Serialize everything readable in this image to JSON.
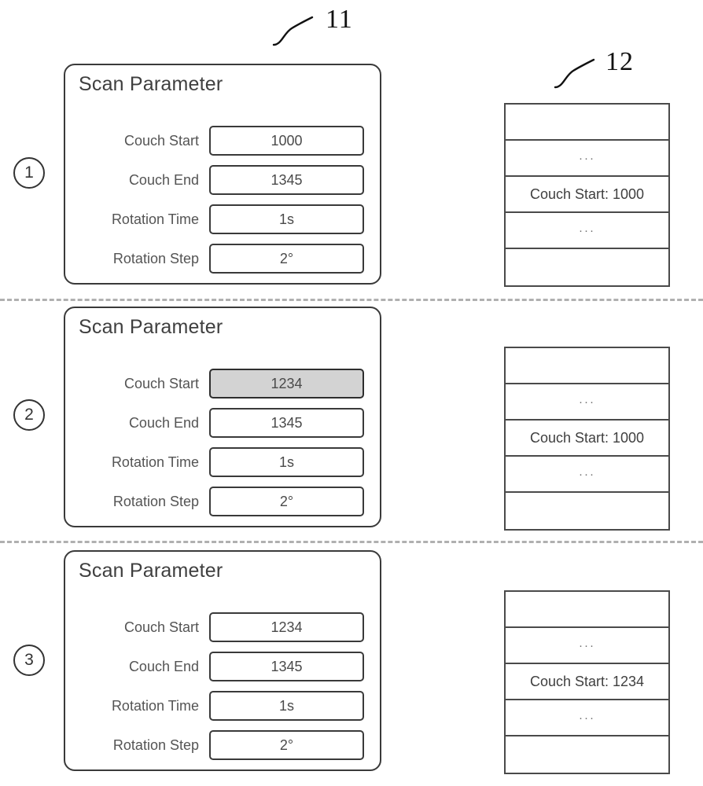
{
  "figure": {
    "refs": [
      {
        "id": "11",
        "label": "11",
        "target": "scan-parameter-dialog"
      },
      {
        "id": "12",
        "label": "12",
        "target": "record-table"
      }
    ]
  },
  "steps": [
    {
      "marker": "①",
      "marker_text": "1",
      "dialog": {
        "title": "Scan Parameter",
        "fields": [
          {
            "label": "Couch Start",
            "value": "1000",
            "highlighted": false
          },
          {
            "label": "Couch End",
            "value": "1345",
            "highlighted": false
          },
          {
            "label": "Rotation Time",
            "value": "1s",
            "highlighted": false
          },
          {
            "label": "Rotation Step",
            "value": "2°",
            "highlighted": false
          }
        ]
      },
      "table": {
        "rows": [
          {
            "text": ""
          },
          {
            "text": "···"
          },
          {
            "text": "Couch Start: 1000"
          },
          {
            "text": "···"
          },
          {
            "text": ""
          }
        ]
      }
    },
    {
      "marker": "②",
      "marker_text": "2",
      "dialog": {
        "title": "Scan Parameter",
        "fields": [
          {
            "label": "Couch Start",
            "value": "1234",
            "highlighted": true
          },
          {
            "label": "Couch End",
            "value": "1345",
            "highlighted": false
          },
          {
            "label": "Rotation Time",
            "value": "1s",
            "highlighted": false
          },
          {
            "label": "Rotation Step",
            "value": "2°",
            "highlighted": false
          }
        ]
      },
      "table": {
        "rows": [
          {
            "text": ""
          },
          {
            "text": "···"
          },
          {
            "text": "Couch Start: 1000"
          },
          {
            "text": "···"
          },
          {
            "text": ""
          }
        ]
      }
    },
    {
      "marker": "③",
      "marker_text": "3",
      "dialog": {
        "title": "Scan Parameter",
        "fields": [
          {
            "label": "Couch Start",
            "value": "1234",
            "highlighted": false
          },
          {
            "label": "Couch End",
            "value": "1345",
            "highlighted": false
          },
          {
            "label": "Rotation Time",
            "value": "1s",
            "highlighted": false
          },
          {
            "label": "Rotation Step",
            "value": "2°",
            "highlighted": false
          }
        ]
      },
      "table": {
        "rows": [
          {
            "text": ""
          },
          {
            "text": "···"
          },
          {
            "text": "Couch Start: 1234"
          },
          {
            "text": "···"
          },
          {
            "text": ""
          }
        ]
      }
    }
  ],
  "colors": {
    "stroke": "#3a3a3a",
    "highlight_fill": "#d3d3d3",
    "divider": "#b0b0b0",
    "text": "#3f3f3f"
  }
}
